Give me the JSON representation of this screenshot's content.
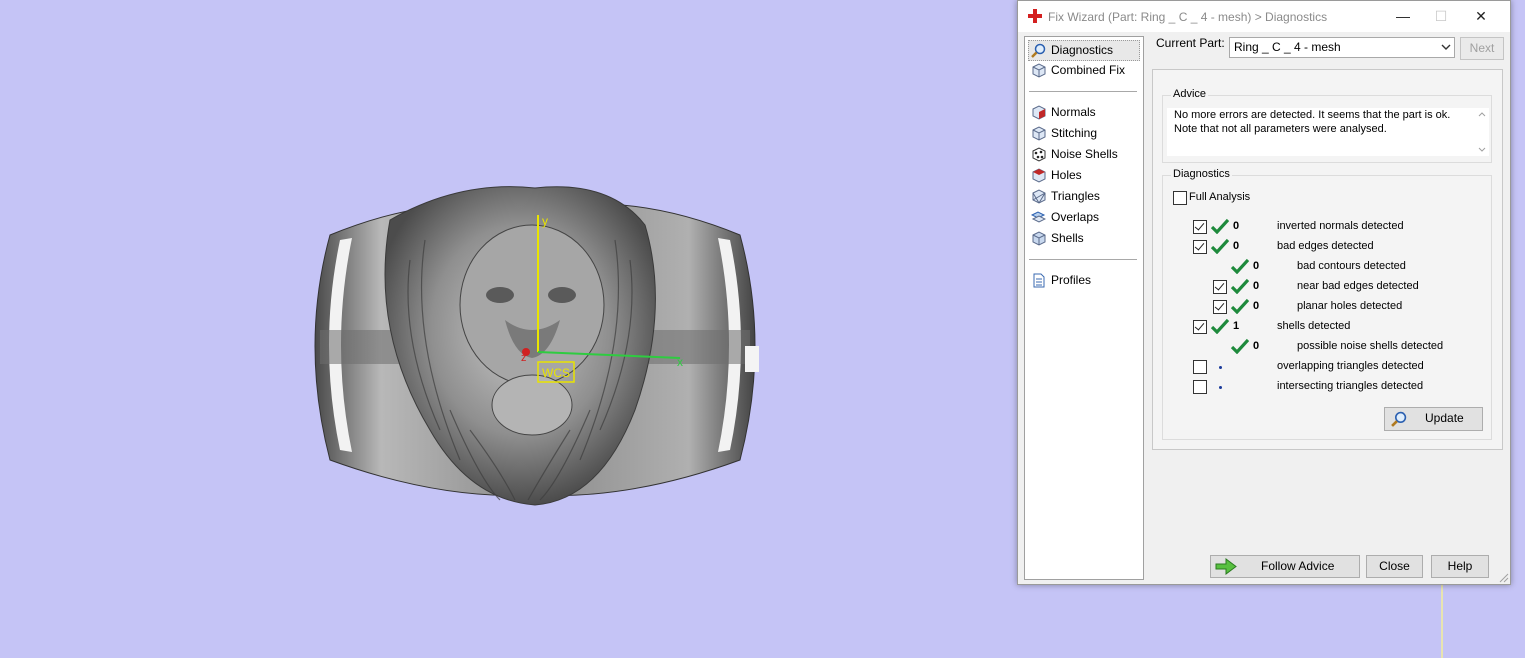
{
  "window": {
    "title": "Fix Wizard (Part: Ring _ C _ 4 - mesh) > Diagnostics",
    "minimize": "—",
    "maximize": "☐",
    "close": "✕"
  },
  "viewport": {
    "wcs_label": "WCS",
    "axis_y": "y",
    "axis_x": "x",
    "axis_z": "z"
  },
  "nav": {
    "items": [
      {
        "label": "Diagnostics",
        "icon": "magnifier-icon"
      },
      {
        "label": "Combined Fix",
        "icon": "cube-icon"
      },
      {
        "label": "Normals",
        "icon": "normals-cube-icon"
      },
      {
        "label": "Stitching",
        "icon": "stitch-cube-icon"
      },
      {
        "label": "Noise Shells",
        "icon": "noise-shells-icon"
      },
      {
        "label": "Holes",
        "icon": "holes-cube-icon"
      },
      {
        "label": "Triangles",
        "icon": "triangles-icon"
      },
      {
        "label": "Overlaps",
        "icon": "overlaps-icon"
      },
      {
        "label": "Shells",
        "icon": "shells-cube-icon"
      },
      {
        "label": "Profiles",
        "icon": "document-icon"
      }
    ]
  },
  "current_part": {
    "label": "Current Part:",
    "value": "Ring _ C _ 4 - mesh",
    "next_label": "Next"
  },
  "advice": {
    "group_label": "Advice",
    "line1": "No more errors are detected. It seems that the part is ok.",
    "line2": "Note that not all parameters were analysed."
  },
  "diagnostics": {
    "group_label": "Diagnostics",
    "full_analysis": "Full Analysis",
    "rows": [
      {
        "count": "0",
        "label": "inverted normals detected"
      },
      {
        "count": "0",
        "label": "bad edges detected"
      },
      {
        "count": "0",
        "label": "bad contours detected"
      },
      {
        "count": "0",
        "label": "near bad edges detected"
      },
      {
        "count": "0",
        "label": "planar holes detected"
      },
      {
        "count": "1",
        "label": "shells detected"
      },
      {
        "count": "0",
        "label": "possible noise shells detected"
      },
      {
        "count": "",
        "label": "overlapping triangles detected"
      },
      {
        "count": "",
        "label": "intersecting triangles detected"
      }
    ],
    "update_label": "Update"
  },
  "footer": {
    "follow_advice": "Follow Advice",
    "close": "Close",
    "help": "Help"
  },
  "colors": {
    "viewport_bg": "#c5c4f6",
    "check_green": "#1e8a3c",
    "wcs_yellow": "#e9e400"
  }
}
